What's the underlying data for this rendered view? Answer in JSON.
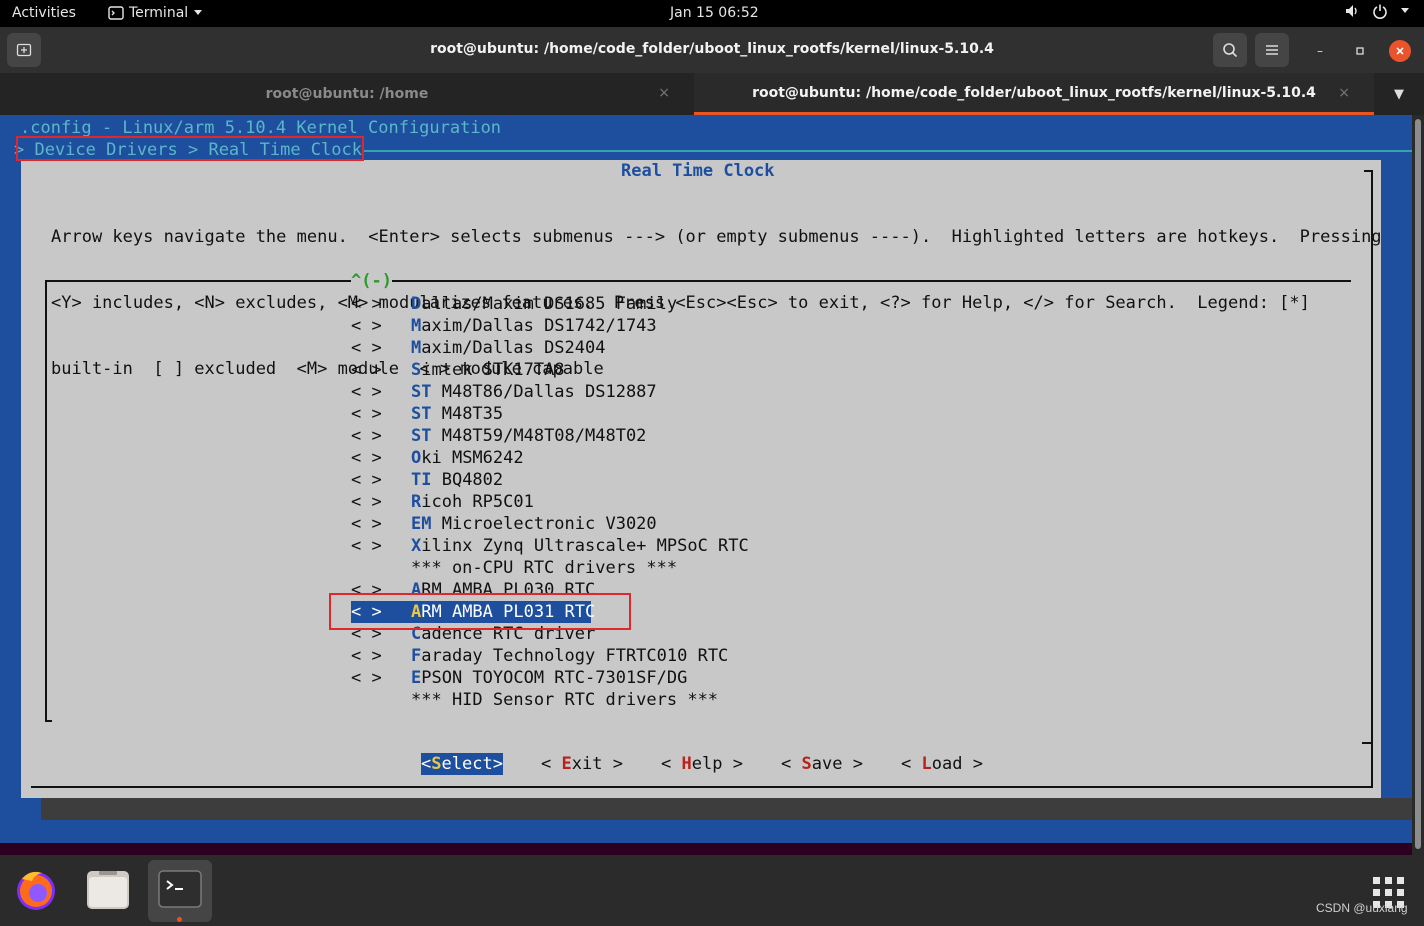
{
  "topbar": {
    "activities": "Activities",
    "app_menu": "Terminal",
    "clock": "Jan 15  06:52"
  },
  "window": {
    "title": "root@ubuntu: /home/code_folder/uboot_linux_rootfs/kernel/linux-5.10.4",
    "tabs": [
      {
        "label": "root@ubuntu: /home",
        "active": false
      },
      {
        "label": "root@ubuntu: /home/code_folder/uboot_linux_rootfs/kernel/linux-5.10.4",
        "active": true
      }
    ]
  },
  "menuconfig": {
    "header_path": ".config - Linux/arm 5.10.4 Kernel Configuration",
    "breadcrumb": "> Device Drivers > Real Time Clock",
    "dialog_title": "Real Time Clock",
    "help_lines": [
      "Arrow keys navigate the menu.  <Enter> selects submenus ---> (or empty submenus ----).  Highlighted letters are hotkeys.  Pressing",
      "<Y> includes, <N> excludes, <M> modularizes features.  Press <Esc><Esc> to exit, <?> for Help, </> for Search.  Legend: [*]",
      "built-in  [ ] excluded  <M> module  < > module capable"
    ],
    "scroll_indicator": "^(-)",
    "items": [
      {
        "bracket": "< >",
        "hotkey": "D",
        "rest": "allas/Maxim DS1685 Family"
      },
      {
        "bracket": "< >",
        "hotkey": "M",
        "rest": "axim/Dallas DS1742/1743"
      },
      {
        "bracket": "< >",
        "hotkey": "M",
        "rest": "axim/Dallas DS2404"
      },
      {
        "bracket": "< >",
        "hotkey": "S",
        "rest": "imtek STK17TA8"
      },
      {
        "bracket": "< >",
        "hotkey": "ST",
        "rest": " M48T86/Dallas DS12887"
      },
      {
        "bracket": "< >",
        "hotkey": "ST",
        "rest": " M48T35"
      },
      {
        "bracket": "< >",
        "hotkey": "ST",
        "rest": " M48T59/M48T08/M48T02"
      },
      {
        "bracket": "< >",
        "hotkey": "O",
        "rest": "ki MSM6242"
      },
      {
        "bracket": "< >",
        "hotkey": "TI",
        "rest": " BQ4802"
      },
      {
        "bracket": "< >",
        "hotkey": "R",
        "rest": "icoh RP5C01"
      },
      {
        "bracket": "< >",
        "hotkey": "EM",
        "rest": " Microelectronic V3020"
      },
      {
        "bracket": "< >",
        "hotkey": "X",
        "rest": "ilinx Zynq Ultrascale+ MPSoC RTC"
      },
      {
        "bracket": "",
        "hotkey": "",
        "rest": "*** on-CPU RTC drivers ***"
      },
      {
        "bracket": "< >",
        "hotkey": "A",
        "rest": "RM AMBA PL030 RTC"
      },
      {
        "bracket": "< >",
        "hotkey": "A",
        "rest": "RM AMBA PL031 RTC",
        "selected": true
      },
      {
        "bracket": "< >",
        "hotkey": "C",
        "rest": "adence RTC driver"
      },
      {
        "bracket": "< >",
        "hotkey": "F",
        "rest": "araday Technology FTRTC010 RTC"
      },
      {
        "bracket": "< >",
        "hotkey": "E",
        "rest": "PSON TOYOCOM RTC-7301SF/DG"
      },
      {
        "bracket": "",
        "hotkey": "",
        "rest": "*** HID Sensor RTC drivers ***"
      }
    ],
    "buttons": [
      {
        "pre": "<",
        "hotkey": "S",
        "rest": "elect",
        "post": ">",
        "selected": true
      },
      {
        "pre": "< ",
        "hotkey": "E",
        "rest": "xit",
        "post": " >"
      },
      {
        "pre": "< ",
        "hotkey": "H",
        "rest": "elp",
        "post": " >"
      },
      {
        "pre": "< ",
        "hotkey": "S",
        "rest": "ave",
        "post": " >"
      },
      {
        "pre": "< ",
        "hotkey": "L",
        "rest": "oad",
        "post": " >"
      }
    ]
  },
  "dock": {
    "apps": [
      "firefox-icon",
      "files-icon",
      "terminal-icon"
    ],
    "watermark": "CSDN @uuxiang"
  },
  "colors": {
    "terminal_bg": "#1e4f9e",
    "dialog_bg": "#c8c8c8",
    "annotation_red": "#e0272b",
    "ubuntu_orange": "#e95420"
  }
}
